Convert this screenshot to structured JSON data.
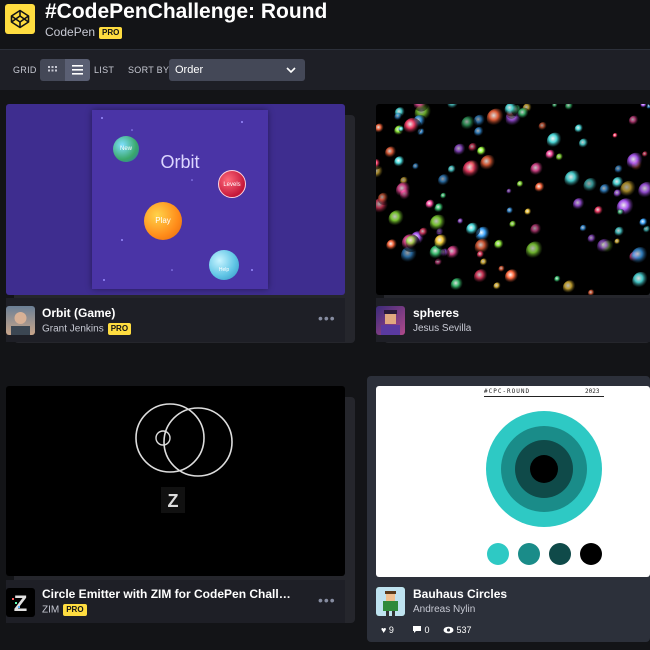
{
  "header": {
    "title": "#CodePenChallenge: Round",
    "owner": "CodePen",
    "pro_badge": "PRO"
  },
  "toolbar": {
    "grid_label": "GRID",
    "list_label": "LIST",
    "sort_label": "SORT BY",
    "sort_value": "Order"
  },
  "cards": [
    {
      "title": "Orbit (Game)",
      "author": "Grant Jenkins",
      "author_pro": "PRO",
      "thumb": {
        "heading": "Orbit",
        "new_label": "New",
        "levels_label": "Levels",
        "play_label": "Play",
        "help_label": "Help"
      }
    },
    {
      "title": "spheres",
      "author": "Jesus Sevilla"
    },
    {
      "title": "Circle Emitter with ZIM for CodePen Chall…",
      "author": "ZIM",
      "author_pro": "PRO"
    },
    {
      "title": "Bauhaus Circles",
      "author": "Andreas Nylin",
      "thumb": {
        "tag": "#CPC-ROUND",
        "year": "2023"
      },
      "stats": {
        "likes": "9",
        "comments": "0",
        "views": "537"
      }
    }
  ],
  "colors": {
    "accent": "#ffdd40",
    "background": "#131417",
    "panel": "#1e1f26"
  }
}
